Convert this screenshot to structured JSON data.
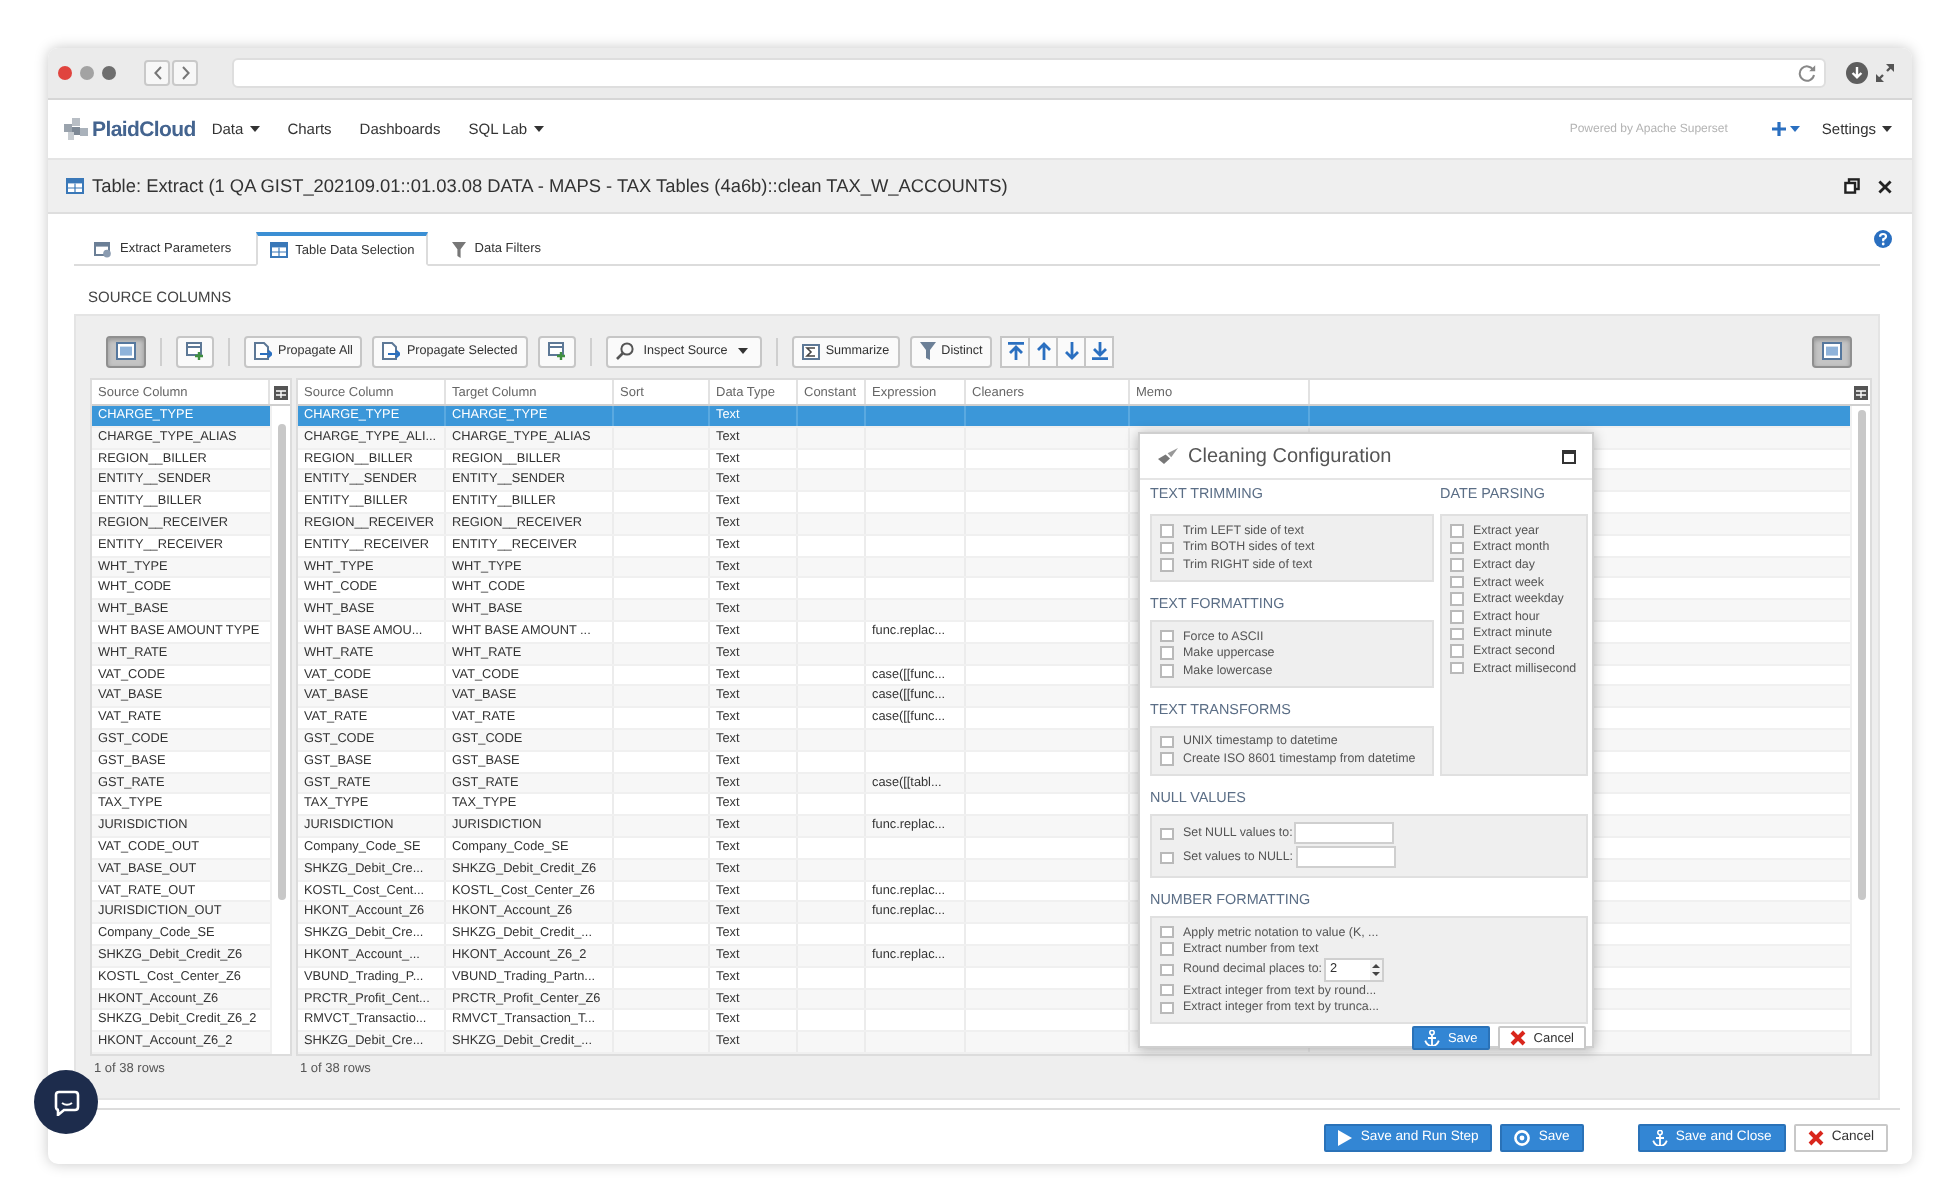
{
  "navbar": {
    "logo": "PlaidCloud",
    "menu": [
      {
        "label": "Data",
        "dropdown": true
      },
      {
        "label": "Charts",
        "dropdown": false
      },
      {
        "label": "Dashboards",
        "dropdown": false
      },
      {
        "label": "SQL Lab",
        "dropdown": true
      }
    ],
    "powered_by": "Powered by Apache Superset",
    "add_menu": {
      "dropdown": true
    },
    "settings": {
      "label": "Settings",
      "dropdown": true
    }
  },
  "window": {
    "title": "Table: Extract (1 QA GIST_202109.01::01.03.08 DATA - MAPS - TAX Tables (4a6b)::clean TAX_W_ACCOUNTS)"
  },
  "tabs": [
    {
      "label": "Extract Parameters",
      "selected": false
    },
    {
      "label": "Table Data Selection",
      "selected": true
    },
    {
      "label": "Data Filters",
      "selected": false
    }
  ],
  "source_columns": {
    "title": "SOURCE COLUMNS",
    "toolbar": {
      "groups": [
        {
          "buttons": [
            {
              "kind": "icon",
              "pressed": true
            }
          ]
        },
        {
          "buttons": [
            {
              "kind": "icon",
              "pressed": false
            }
          ]
        },
        {
          "buttons": [
            {
              "kind": "text",
              "label": "Propagate All"
            },
            {
              "kind": "text",
              "label": "Propagate Selected"
            },
            {
              "kind": "icon",
              "pressed": false
            }
          ]
        },
        {
          "buttons": [
            {
              "kind": "dropdown",
              "label": "Inspect Source"
            }
          ]
        },
        {
          "buttons": [
            {
              "kind": "text",
              "label": "Summarize"
            },
            {
              "kind": "text",
              "label": "Distinct"
            }
          ]
        },
        {
          "buttons": [
            {
              "kind": "arrow"
            },
            {
              "kind": "arrow"
            },
            {
              "kind": "arrow"
            },
            {
              "kind": "arrow"
            }
          ]
        }
      ],
      "right_button": {
        "pressed": true
      }
    }
  },
  "source_list": {
    "column": "Source Column",
    "rows": [
      {
        "name": "CHARGE_TYPE",
        "selected": true
      },
      {
        "name": "CHARGE_TYPE_ALIAS",
        "selected": false
      },
      {
        "name": "REGION__BILLER",
        "selected": false
      },
      {
        "name": "ENTITY__SENDER",
        "selected": false
      },
      {
        "name": "ENTITY__BILLER",
        "selected": false
      },
      {
        "name": "REGION__RECEIVER",
        "selected": false
      },
      {
        "name": "ENTITY__RECEIVER",
        "selected": false
      },
      {
        "name": "WHT_TYPE",
        "selected": false
      },
      {
        "name": "WHT_CODE",
        "selected": false
      },
      {
        "name": "WHT_BASE",
        "selected": false
      },
      {
        "name": "WHT BASE AMOUNT TYPE",
        "selected": false
      },
      {
        "name": "WHT_RATE",
        "selected": false
      },
      {
        "name": "VAT_CODE",
        "selected": false
      },
      {
        "name": "VAT_BASE",
        "selected": false
      },
      {
        "name": "VAT_RATE",
        "selected": false
      },
      {
        "name": "GST_CODE",
        "selected": false
      },
      {
        "name": "GST_BASE",
        "selected": false
      },
      {
        "name": "GST_RATE",
        "selected": false
      },
      {
        "name": "TAX_TYPE",
        "selected": false
      },
      {
        "name": "JURISDICTION",
        "selected": false
      },
      {
        "name": "VAT_CODE_OUT",
        "selected": false
      },
      {
        "name": "VAT_BASE_OUT",
        "selected": false
      },
      {
        "name": "VAT_RATE_OUT",
        "selected": false
      },
      {
        "name": "JURISDICTION_OUT",
        "selected": false
      },
      {
        "name": "Company_Code_SE",
        "selected": false
      },
      {
        "name": "SHKZG_Debit_Credit_Z6",
        "selected": false
      },
      {
        "name": "KOSTL_Cost_Center_Z6",
        "selected": false
      },
      {
        "name": "HKONT_Account_Z6",
        "selected": false
      },
      {
        "name": "SHKZG_Debit_Credit_Z6_2",
        "selected": false
      },
      {
        "name": "HKONT_Account_Z6_2",
        "selected": false
      }
    ],
    "footer": "1 of 38 rows"
  },
  "grid": {
    "columns": [
      "Source Column",
      "Target Column",
      "Sort",
      "Data Type",
      "Constant",
      "Expression",
      "Cleaners",
      "Memo"
    ],
    "rows": [
      {
        "source": "CHARGE_TYPE",
        "target": "CHARGE_TYPE",
        "data_type": "Text",
        "selected": true
      },
      {
        "source": "CHARGE_TYPE_ALI...",
        "target": "CHARGE_TYPE_ALIAS",
        "data_type": "Text",
        "selected": false
      },
      {
        "source": "REGION__BILLER",
        "target": "REGION__BILLER",
        "data_type": "Text",
        "selected": false
      },
      {
        "source": "ENTITY__SENDER",
        "target": "ENTITY__SENDER",
        "data_type": "Text",
        "selected": false
      },
      {
        "source": "ENTITY__BILLER",
        "target": "ENTITY__BILLER",
        "data_type": "Text",
        "selected": false
      },
      {
        "source": "REGION__RECEIVER",
        "target": "REGION__RECEIVER",
        "data_type": "Text",
        "selected": false
      },
      {
        "source": "ENTITY__RECEIVER",
        "target": "ENTITY__RECEIVER",
        "data_type": "Text",
        "selected": false
      },
      {
        "source": "WHT_TYPE",
        "target": "WHT_TYPE",
        "data_type": "Text",
        "selected": false
      },
      {
        "source": "WHT_CODE",
        "target": "WHT_CODE",
        "data_type": "Text",
        "selected": false
      },
      {
        "source": "WHT_BASE",
        "target": "WHT_BASE",
        "data_type": "Text",
        "selected": false
      },
      {
        "source": "WHT BASE AMOU...",
        "target": "WHT BASE AMOUNT ...",
        "data_type": "Text",
        "expression": "func.replac...",
        "selected": false
      },
      {
        "source": "WHT_RATE",
        "target": "WHT_RATE",
        "data_type": "Text",
        "selected": false
      },
      {
        "source": "VAT_CODE",
        "target": "VAT_CODE",
        "data_type": "Text",
        "expression": "case([[func...",
        "selected": false
      },
      {
        "source": "VAT_BASE",
        "target": "VAT_BASE",
        "data_type": "Text",
        "expression": "case([[func...",
        "selected": false
      },
      {
        "source": "VAT_RATE",
        "target": "VAT_RATE",
        "data_type": "Text",
        "expression": "case([[func...",
        "selected": false
      },
      {
        "source": "GST_CODE",
        "target": "GST_CODE",
        "data_type": "Text",
        "selected": false
      },
      {
        "source": "GST_BASE",
        "target": "GST_BASE",
        "data_type": "Text",
        "selected": false
      },
      {
        "source": "GST_RATE",
        "target": "GST_RATE",
        "data_type": "Text",
        "expression": "case([[tabl...",
        "selected": false
      },
      {
        "source": "TAX_TYPE",
        "target": "TAX_TYPE",
        "data_type": "Text",
        "selected": false
      },
      {
        "source": "JURISDICTION",
        "target": "JURISDICTION",
        "data_type": "Text",
        "expression": "func.replac...",
        "selected": false
      },
      {
        "source": "Company_Code_SE",
        "target": "Company_Code_SE",
        "data_type": "Text",
        "selected": false
      },
      {
        "source": "SHKZG_Debit_Cre...",
        "target": "SHKZG_Debit_Credit_Z6",
        "data_type": "Text",
        "selected": false
      },
      {
        "source": "KOSTL_Cost_Cent...",
        "target": "KOSTL_Cost_Center_Z6",
        "data_type": "Text",
        "expression": "func.replac...",
        "selected": false
      },
      {
        "source": "HKONT_Account_Z6",
        "target": "HKONT_Account_Z6",
        "data_type": "Text",
        "expression": "func.replac...",
        "selected": false
      },
      {
        "source": "SHKZG_Debit_Cre...",
        "target": "SHKZG_Debit_Credit_...",
        "data_type": "Text",
        "selected": false
      },
      {
        "source": "HKONT_Account_...",
        "target": "HKONT_Account_Z6_2",
        "data_type": "Text",
        "expression": "func.replac...",
        "selected": false
      },
      {
        "source": "VBUND_Trading_P...",
        "target": "VBUND_Trading_Partn...",
        "data_type": "Text",
        "selected": false
      },
      {
        "source": "PRCTR_Profit_Cent...",
        "target": "PRCTR_Profit_Center_Z6",
        "data_type": "Text",
        "selected": false
      },
      {
        "source": "RMVCT_Transactio...",
        "target": "RMVCT_Transaction_T...",
        "data_type": "Text",
        "selected": false
      },
      {
        "source": "SHKZG_Debit_Cre...",
        "target": "SHKZG_Debit_Credit_...",
        "data_type": "Text",
        "selected": false
      }
    ],
    "footer": "1 of 38 rows"
  },
  "cleaning_dialog": {
    "title": "Cleaning Configuration",
    "columns": [
      {
        "sections": [
          {
            "title": "TEXT TRIMMING",
            "options": [
              {
                "kind": "check",
                "label": "Trim LEFT side of text",
                "checked": false
              },
              {
                "kind": "check",
                "label": "Trim BOTH sides of text",
                "checked": false
              },
              {
                "kind": "check",
                "label": "Trim RIGHT side of text",
                "checked": false
              }
            ]
          },
          {
            "title": "TEXT FORMATTING",
            "options": [
              {
                "kind": "check",
                "label": "Force to ASCII",
                "checked": false
              },
              {
                "kind": "check",
                "label": "Make uppercase",
                "checked": false
              },
              {
                "kind": "check",
                "label": "Make lowercase",
                "checked": false
              }
            ]
          },
          {
            "title": "TEXT TRANSFORMS",
            "options": [
              {
                "kind": "check",
                "label": "UNIX timestamp to datetime",
                "checked": false
              },
              {
                "kind": "check",
                "label": "Create ISO 8601 timestamp from datetime",
                "checked": false
              }
            ]
          }
        ]
      },
      {
        "sections": [
          {
            "title": "DATE PARSING",
            "options": [
              {
                "kind": "check",
                "label": "Extract year",
                "checked": false
              },
              {
                "kind": "check",
                "label": "Extract month",
                "checked": false
              },
              {
                "kind": "check",
                "label": "Extract day",
                "checked": false
              },
              {
                "kind": "check",
                "label": "Extract week",
                "checked": false
              },
              {
                "kind": "check",
                "label": "Extract weekday",
                "checked": false
              },
              {
                "kind": "check",
                "label": "Extract hour",
                "checked": false
              },
              {
                "kind": "check",
                "label": "Extract minute",
                "checked": false
              },
              {
                "kind": "check",
                "label": "Extract second",
                "checked": false
              },
              {
                "kind": "check",
                "label": "Extract millisecond",
                "checked": false
              }
            ]
          }
        ]
      }
    ],
    "sections": [
      {
        "title": "NULL VALUES",
        "options": [
          {
            "kind": "input",
            "label": "Set NULL values to:",
            "checked": false
          },
          {
            "kind": "input",
            "label": "Set values to NULL:",
            "checked": false
          }
        ]
      },
      {
        "title": "NUMBER FORMATTING",
        "options": [
          {
            "kind": "check",
            "label": "Apply metric notation to value (K, ...",
            "checked": false
          },
          {
            "kind": "check",
            "label": "Extract number from text",
            "checked": false
          },
          {
            "kind": "number",
            "label": "Round decimal places to:",
            "checked": false,
            "value": "2"
          },
          {
            "kind": "check",
            "label": "Extract integer from text by round...",
            "checked": false
          },
          {
            "kind": "check",
            "label": "Extract integer from text by trunca...",
            "checked": false
          }
        ]
      }
    ],
    "buttons": [
      {
        "kind": "primary",
        "label": "Save"
      },
      {
        "kind": "cancel",
        "label": "Cancel"
      }
    ]
  },
  "footer": {
    "groups": [
      {
        "buttons": [
          {
            "kind": "primary",
            "label": "Save and Run Step"
          },
          {
            "kind": "primary",
            "label": "Save"
          }
        ]
      },
      {
        "buttons": [
          {
            "kind": "primary",
            "label": "Save and Close"
          },
          {
            "kind": "cancel",
            "label": "Cancel"
          }
        ]
      }
    ]
  }
}
